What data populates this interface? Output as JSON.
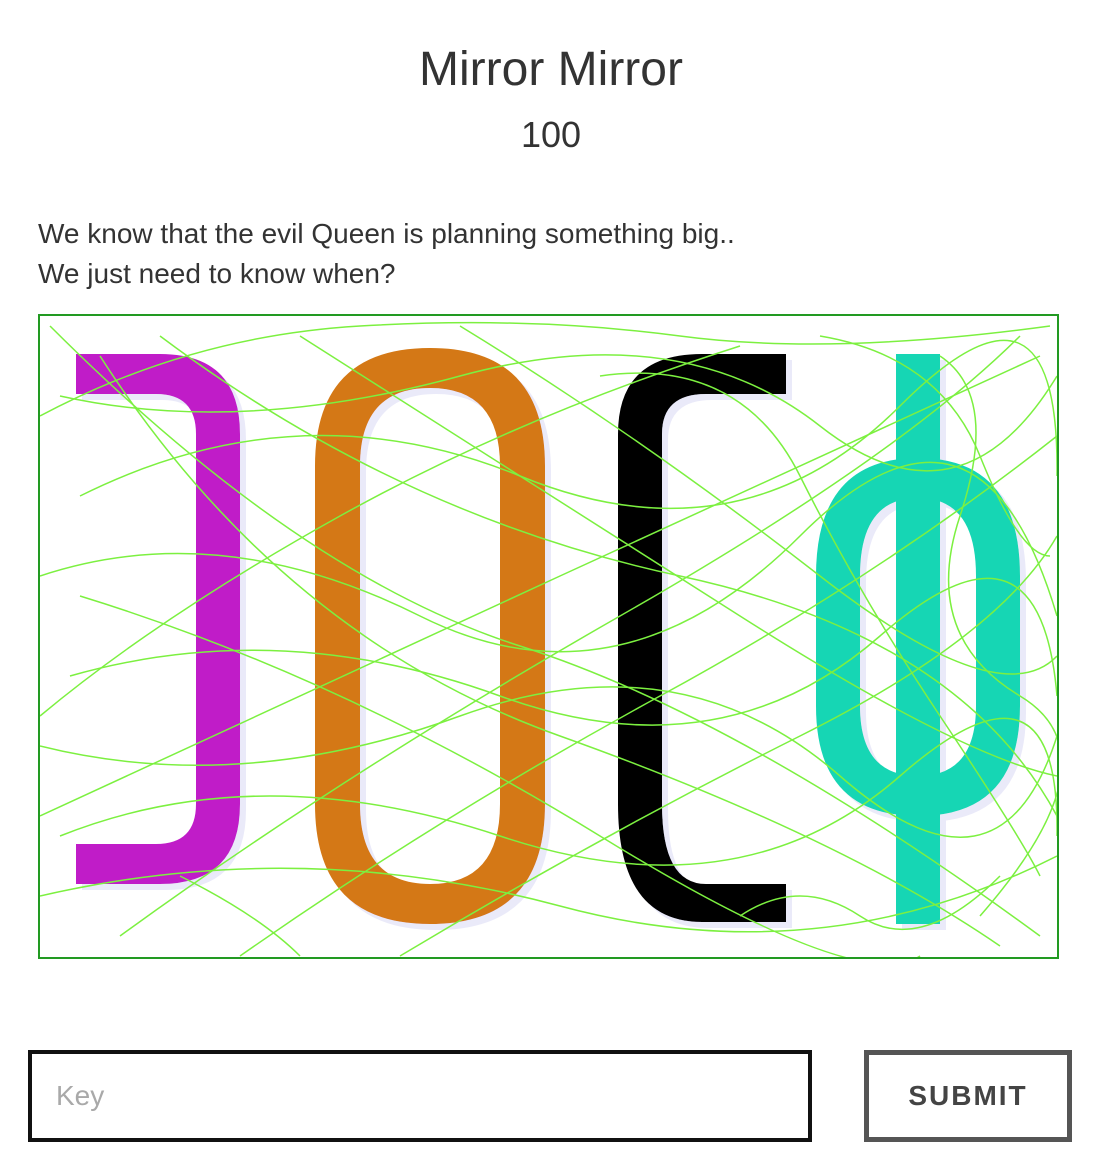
{
  "challenge": {
    "title": "Mirror Mirror",
    "points": "100",
    "description_lines": [
      "We know that the evil Queen is planning something big..",
      "We just need to know when?"
    ]
  },
  "captcha_image": {
    "border_color": "#229a22",
    "noise_color": "#7cf040",
    "glyphs": [
      {
        "name": "mirrored-c-glyph",
        "color": "#c01cc8"
      },
      {
        "name": "zero-glyph",
        "color": "#d47812"
      },
      {
        "name": "bracket-c-glyph",
        "color": "#000000"
      },
      {
        "name": "phi-glyph",
        "color": "#14d6b4"
      }
    ]
  },
  "form": {
    "key_placeholder": "Key",
    "key_value": "",
    "submit_label": "SUBMIT"
  }
}
